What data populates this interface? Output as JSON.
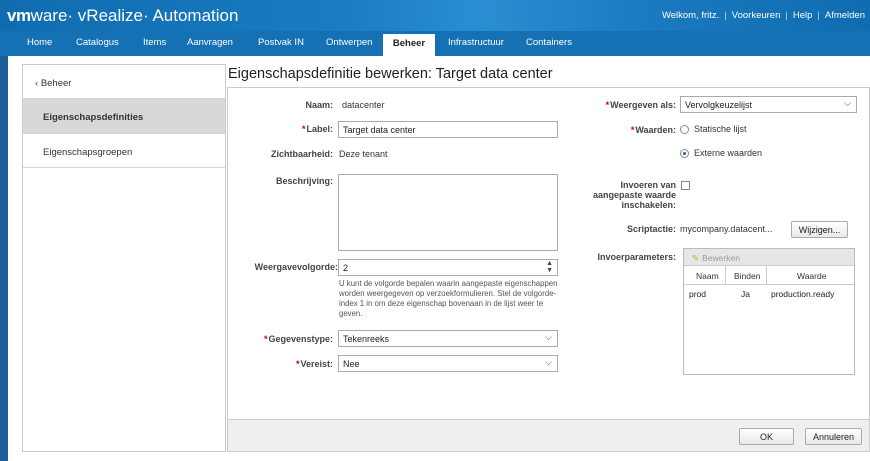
{
  "app": {
    "brand_vm": "vm",
    "brand_rest": "ware· vRealize· Automation"
  },
  "user_bar": {
    "welcome": "Welkom, fritz.",
    "preferences": "Voorkeuren",
    "help": "Help",
    "logout": "Afmelden"
  },
  "nav": [
    {
      "label": "Home"
    },
    {
      "label": "Catalogus"
    },
    {
      "label": "Items"
    },
    {
      "label": "Aanvragen"
    },
    {
      "label": "Postvak IN"
    },
    {
      "label": "Ontwerpen"
    },
    {
      "label": "Beheer"
    },
    {
      "label": "Infrastructuur"
    },
    {
      "label": "Containers"
    }
  ],
  "nav_active": "Beheer",
  "sidebar": {
    "back_label": "Beheer",
    "items": [
      {
        "label": "Eigenschapsdefinities",
        "active": true
      },
      {
        "label": "Eigenschapsgroepen",
        "active": false
      }
    ]
  },
  "page_title": "Eigenschapsdefinitie bewerken: Target data center",
  "form": {
    "name_label": "Naam:",
    "name_value": "datacenter",
    "label_label": "Label:",
    "label_value": "Target data center",
    "visibility_label": "Zichtbaarheid:",
    "visibility_value": "Deze tenant",
    "description_label": "Beschrijving:",
    "description_value": "",
    "order_label": "Weergavevolgorde:",
    "order_value": "2",
    "order_help": "U kunt de volgorde bepalen waarin aangepaste eigenschappen worden weergegeven op verzoekformulieren. Stel de volgorde-index 1 in om deze eigenschap bovenaan in de lijst weer te geven.",
    "datatype_label": "Gegevenstype:",
    "datatype_value": "Tekenreeks",
    "required_label": "Vereist:",
    "required_value": "Nee",
    "display_as_label": "Weergeven als:",
    "display_as_value": "Vervolgkeuzelijst",
    "values_label": "Waarden:",
    "values_option_static": "Statische lijst",
    "values_option_external": "Externe waarden",
    "values_selected": "Externe waarden",
    "custom_value_label_1": "Invoeren van",
    "custom_value_label_2": "aangepaste waarde",
    "custom_value_label_3": "inschakelen:",
    "custom_value_checked": false,
    "script_label": "Scriptactie:",
    "script_value": "mycompany.datacent...",
    "script_button": "Wijzigen...",
    "input_params_label": "Invoerparameters:",
    "grid": {
      "toolbar_edit": "Bewerken",
      "columns": [
        "Naam",
        "Binden",
        "Waarde"
      ],
      "rows": [
        {
          "name": "prod",
          "bind": "Ja",
          "value": "production.ready"
        }
      ]
    }
  },
  "buttons": {
    "ok": "OK",
    "cancel": "Annuleren"
  },
  "colors": {
    "header_blue": "#1570b4",
    "required_red": "#cc0000",
    "active_sidebar": "#d8d8d8"
  }
}
